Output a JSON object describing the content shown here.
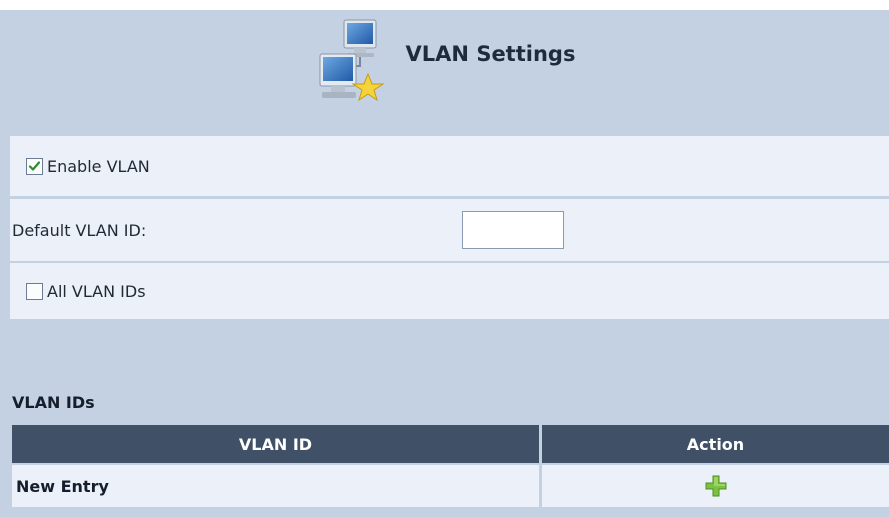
{
  "header": {
    "title": "VLAN Settings",
    "icon": "network-computers-star-icon"
  },
  "form": {
    "enable_vlan": {
      "label": "Enable VLAN",
      "checked": true
    },
    "default_vlan_id": {
      "label": "Default VLAN ID:",
      "value": ""
    },
    "all_vlan_ids": {
      "label": "All VLAN IDs",
      "checked": false
    }
  },
  "vlan_table": {
    "title": "VLAN IDs",
    "columns": [
      "VLAN ID",
      "Action"
    ],
    "rows": [
      {
        "vlan_id": "New Entry",
        "action_icon": "add-plus-icon"
      }
    ]
  },
  "colors": {
    "panel_bg": "#c3d1e3",
    "row_bg": "#ecf0f8",
    "table_header_bg": "#3f5067",
    "checkmark": "#2e8b2e",
    "add_icon": "#7cc242"
  }
}
